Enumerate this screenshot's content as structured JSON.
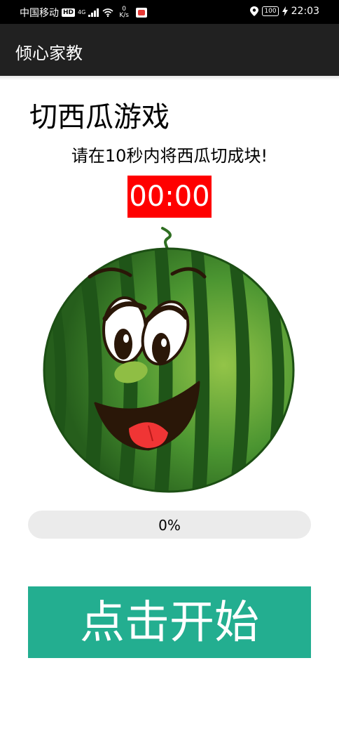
{
  "status_bar": {
    "carrier": "中国移动",
    "hd_badge": "HD",
    "network": "4G",
    "net_speed_value": "0",
    "net_speed_unit": "K/s",
    "battery": "100",
    "time": "22:03"
  },
  "app_bar": {
    "title": "倾心家教"
  },
  "game": {
    "title": "切西瓜游戏",
    "instruction": "请在10秒内将西瓜切成块!",
    "timer": "00:00",
    "progress_label": "0%",
    "progress_value": 0,
    "start_label": "点击开始"
  },
  "colors": {
    "accent": "#23ae90",
    "timer_bg": "#ff0000",
    "app_bar": "#212121",
    "progress_track": "#ebebeb"
  }
}
